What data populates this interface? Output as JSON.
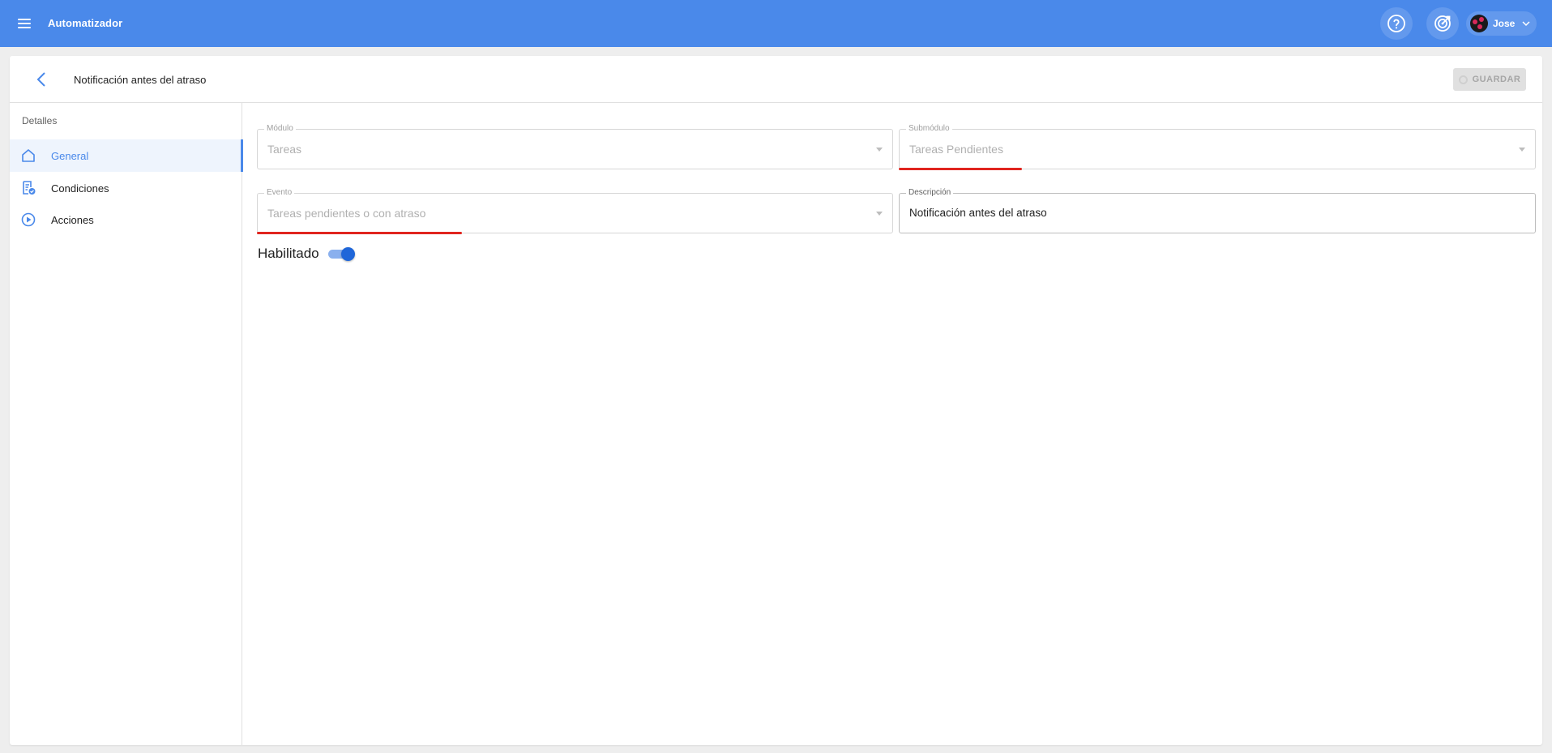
{
  "topbar": {
    "menu_icon": "hamburger-icon",
    "app_title": "Automatizador",
    "help_icon": "question-circle-icon",
    "target_icon": "target-icon",
    "user": {
      "name": "Jose",
      "avatar_icon": "user-avatar",
      "chevron_icon": "chevron-down-icon"
    },
    "bg_color": "#4a89ea"
  },
  "header": {
    "back_icon": "chevron-left-icon",
    "title": "Notificación antes del atraso",
    "save_label": "GUARDAR"
  },
  "sidebar": {
    "heading": "Detalles",
    "items": [
      {
        "label": "General",
        "icon": "home-icon",
        "active": true
      },
      {
        "label": "Condiciones",
        "icon": "checklist-icon",
        "active": false
      },
      {
        "label": "Acciones",
        "icon": "play-circle-icon",
        "active": false
      }
    ]
  },
  "form": {
    "modulo": {
      "label": "Módulo",
      "value": "Tareas"
    },
    "submodulo": {
      "label": "Submódulo",
      "value": "Tareas Pendientes"
    },
    "evento": {
      "label": "Evento",
      "value": "Tareas pendientes o con atraso"
    },
    "descripcion": {
      "label": "Descripción",
      "value": "Notificación antes del atraso"
    },
    "habilitado": {
      "label": "Habilitado",
      "enabled": true
    }
  },
  "colors": {
    "accent": "#4a89ea",
    "toggle_on": "#1f66d9",
    "annotation": "#e0251f"
  }
}
